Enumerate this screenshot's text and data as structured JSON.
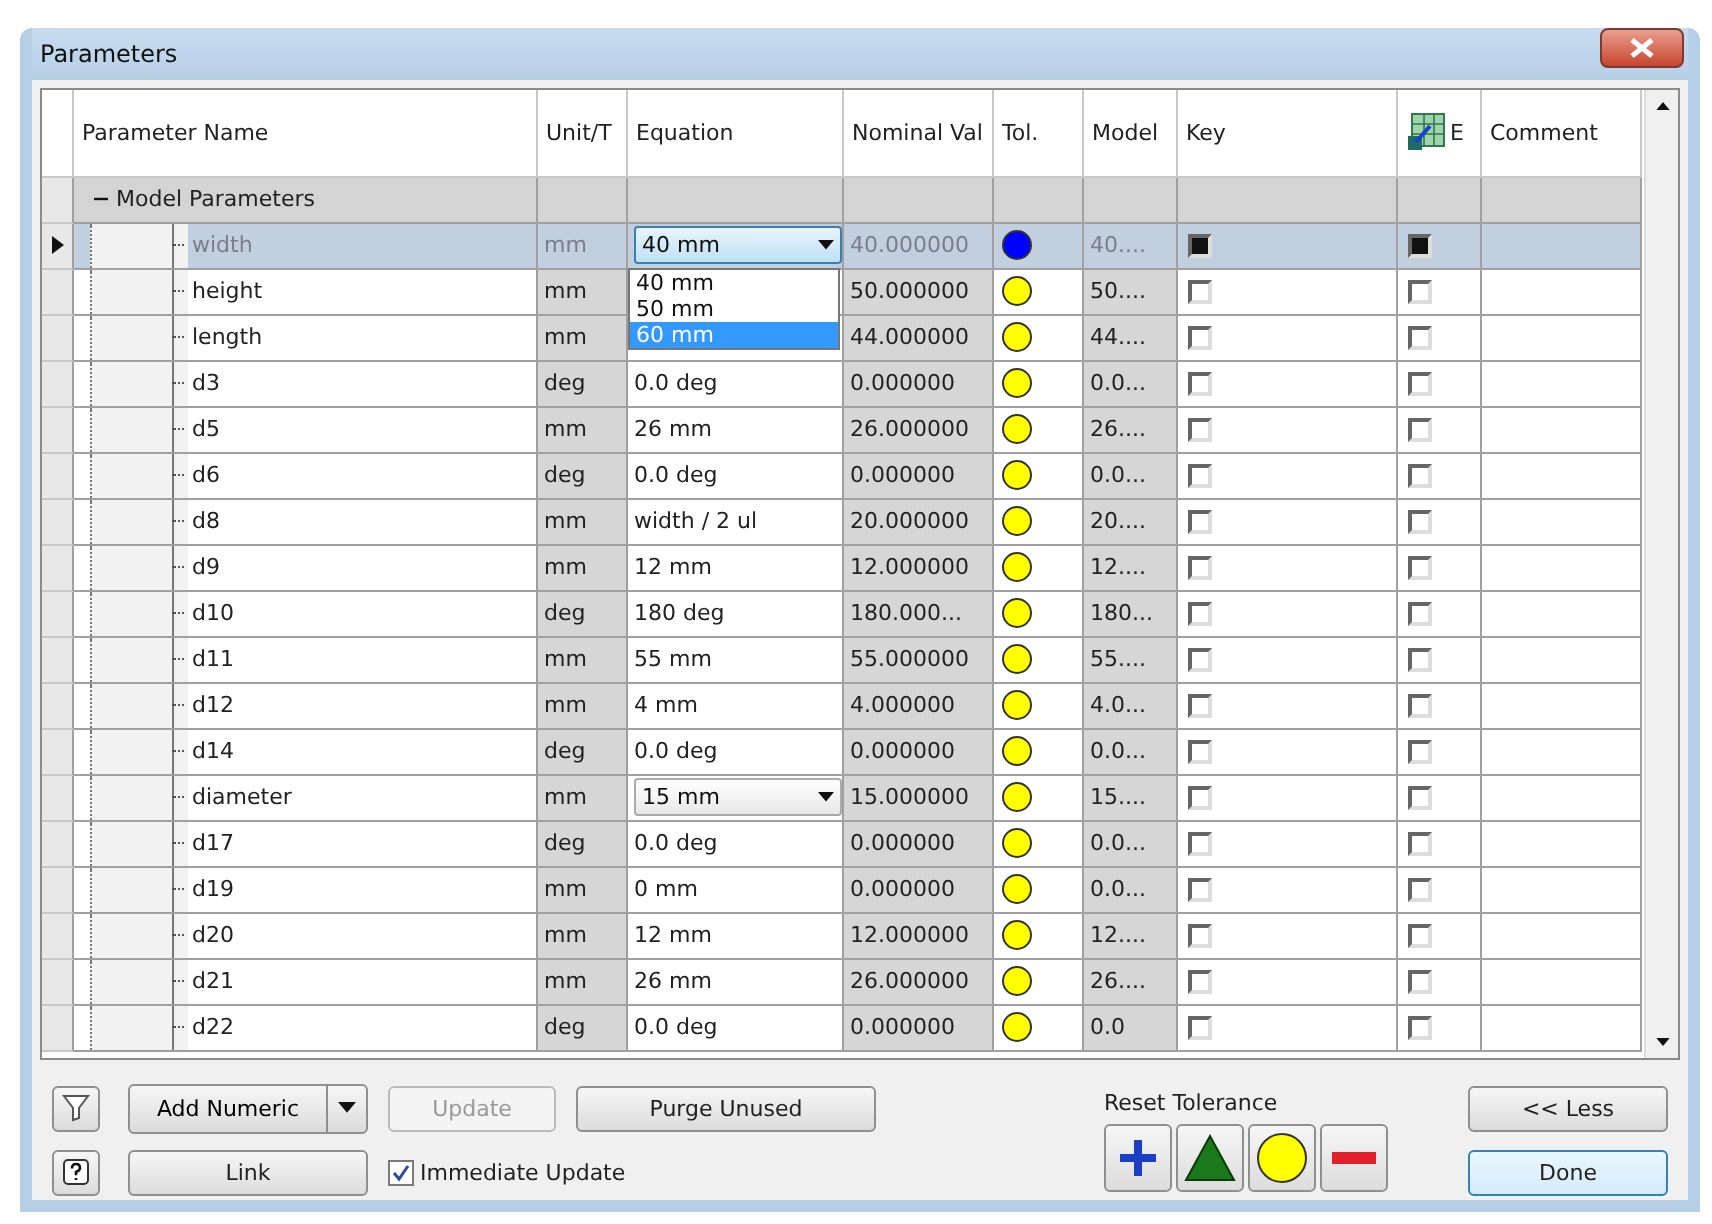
{
  "window": {
    "title": "Parameters"
  },
  "table": {
    "columns": [
      {
        "label": "Parameter Name",
        "kind": "text"
      },
      {
        "label": "Unit/T",
        "kind": "text"
      },
      {
        "label": "Equation",
        "kind": "text"
      },
      {
        "label": "Nominal Val",
        "kind": "text"
      },
      {
        "label": "Tol.",
        "kind": "text"
      },
      {
        "label": "Model",
        "kind": "text"
      },
      {
        "label": "Key",
        "kind": "text"
      },
      {
        "label": "E",
        "kind": "icon"
      },
      {
        "label": "Comment",
        "kind": "text"
      }
    ],
    "groups": [
      {
        "name": "Model Parameters",
        "expanded": true,
        "children": [
          {
            "name": "width",
            "unit": "mm",
            "equation": "40 mm",
            "dropdown": true,
            "options": [
              {
                "label": "40 mm",
                "selected": false
              },
              {
                "label": "50 mm",
                "selected": false
              },
              {
                "label": "60 mm",
                "selected": true
              }
            ],
            "nominal": "40.000000",
            "color": "#0000ff",
            "model": "40....",
            "key": true,
            "export": true,
            "selected": true
          },
          {
            "name": "height",
            "unit": "mm",
            "dropdown": false,
            "nominal": "50.000000",
            "color": "#ffff00",
            "model": "50....",
            "key": false,
            "export": false,
            "selected": false
          },
          {
            "name": "length",
            "unit": "mm",
            "dropdown": false,
            "nominal": "44.000000",
            "color": "#ffff00",
            "model": "44....",
            "key": false,
            "export": false,
            "selected": false
          },
          {
            "name": "d3",
            "unit": "deg",
            "equation": "0.0 deg",
            "dropdown": false,
            "nominal": "0.000000",
            "color": "#ffff00",
            "model": "0.0...",
            "key": false,
            "export": false,
            "selected": false
          },
          {
            "name": "d5",
            "unit": "mm",
            "equation": "26 mm",
            "dropdown": false,
            "nominal": "26.000000",
            "color": "#ffff00",
            "model": "26....",
            "key": false,
            "export": false,
            "selected": false
          },
          {
            "name": "d6",
            "unit": "deg",
            "equation": "0.0 deg",
            "dropdown": false,
            "nominal": "0.000000",
            "color": "#ffff00",
            "model": "0.0...",
            "key": false,
            "export": false,
            "selected": false
          },
          {
            "name": "d8",
            "unit": "mm",
            "equation": "width / 2 ul",
            "dropdown": false,
            "nominal": "20.000000",
            "color": "#ffff00",
            "model": "20....",
            "key": false,
            "export": false,
            "selected": false
          },
          {
            "name": "d9",
            "unit": "mm",
            "equation": "12 mm",
            "dropdown": false,
            "nominal": "12.000000",
            "color": "#ffff00",
            "model": "12....",
            "key": false,
            "export": false,
            "selected": false
          },
          {
            "name": "d10",
            "unit": "deg",
            "equation": "180 deg",
            "dropdown": false,
            "nominal": "180.000...",
            "color": "#ffff00",
            "model": "180...",
            "key": false,
            "export": false,
            "selected": false
          },
          {
            "name": "d11",
            "unit": "mm",
            "equation": "55 mm",
            "dropdown": false,
            "nominal": "55.000000",
            "color": "#ffff00",
            "model": "55....",
            "key": false,
            "export": false,
            "selected": false
          },
          {
            "name": "d12",
            "unit": "mm",
            "equation": "4 mm",
            "dropdown": false,
            "nominal": "4.000000",
            "color": "#ffff00",
            "model": "4.0...",
            "key": false,
            "export": false,
            "selected": false
          },
          {
            "name": "d14",
            "unit": "deg",
            "equation": "0.0 deg",
            "dropdown": false,
            "nominal": "0.000000",
            "color": "#ffff00",
            "model": "0.0...",
            "key": false,
            "export": false,
            "selected": false
          },
          {
            "name": "diameter",
            "unit": "mm",
            "equation": "15 mm",
            "dropdown": true,
            "nominal": "15.000000",
            "color": "#ffff00",
            "model": "15....",
            "key": false,
            "export": false,
            "selected": false
          },
          {
            "name": "d17",
            "unit": "deg",
            "equation": "0.0 deg",
            "dropdown": false,
            "nominal": "0.000000",
            "color": "#ffff00",
            "model": "0.0...",
            "key": false,
            "export": false,
            "selected": false
          },
          {
            "name": "d19",
            "unit": "mm",
            "equation": "0 mm",
            "dropdown": false,
            "nominal": "0.000000",
            "color": "#ffff00",
            "model": "0.0...",
            "key": false,
            "export": false,
            "selected": false
          },
          {
            "name": "d20",
            "unit": "mm",
            "equation": "12 mm",
            "dropdown": false,
            "nominal": "12.000000",
            "color": "#ffff00",
            "model": "12....",
            "key": false,
            "export": false,
            "selected": false
          },
          {
            "name": "d21",
            "unit": "mm",
            "equation": "26 mm",
            "dropdown": false,
            "nominal": "26.000000",
            "color": "#ffff00",
            "model": "26....",
            "key": false,
            "export": false,
            "selected": false
          },
          {
            "name": "d22",
            "unit": "deg",
            "equation": "0.0 deg",
            "dropdown": false,
            "nominal": "0.000000",
            "color": "#ffff00",
            "model": "0.0",
            "key": false,
            "export": false,
            "selected": false
          }
        ]
      }
    ]
  },
  "bottom": {
    "add_button": "Add Numeric",
    "update_button": {
      "label": "Update",
      "disabled": true
    },
    "purge_button": "Purge Unused",
    "link_button": "Link",
    "immediate_update": {
      "label": "Immediate Update",
      "checked": true
    },
    "reset_tolerance": {
      "label": "Reset Tolerance"
    },
    "less_button": "<< Less",
    "done_button": "Done"
  }
}
